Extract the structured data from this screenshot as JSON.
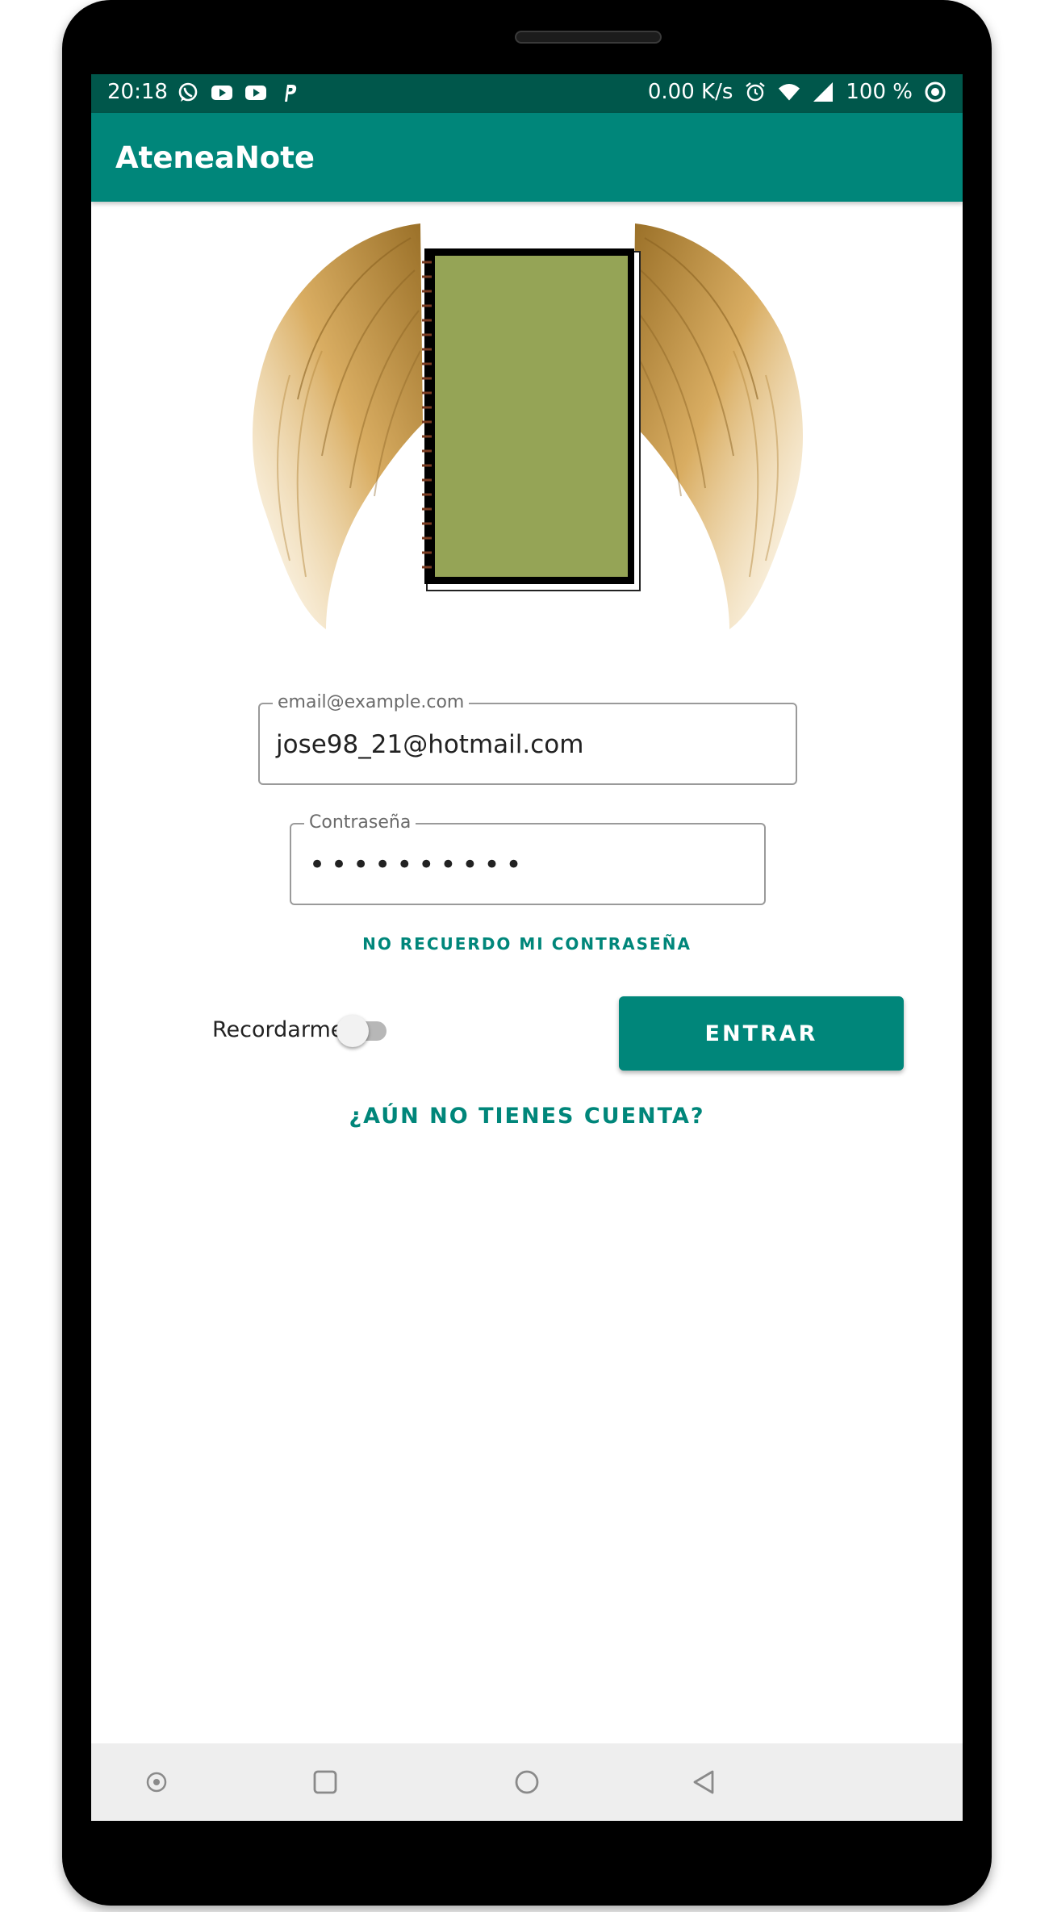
{
  "status_bar": {
    "time": "20:18",
    "net_speed": "0.00 K/s",
    "battery": "100 %",
    "left_icons": [
      "whatsapp-icon",
      "youtube-icon",
      "youtube-icon",
      "paypal-icon"
    ],
    "right_icons": [
      "alarm-icon",
      "wifi-icon",
      "signal-icon",
      "battery-saver-icon"
    ]
  },
  "app_bar": {
    "title": "AteneaNote"
  },
  "login": {
    "email_label": "email@example.com",
    "email_value": "jose98_21@hotmail.com",
    "password_label": "Contraseña",
    "password_masked": "••••••••••",
    "forgot_password": "NO RECUERDO MI CONTRASEÑA",
    "remember_label": "Recordarme",
    "remember_checked": false,
    "enter_button": "ENTRAR",
    "signup_link": "¿AÚN NO TIENES CUENTA?"
  },
  "nav_bar": {
    "icons": [
      "assistant-icon",
      "recents-icon",
      "home-icon",
      "back-icon"
    ]
  },
  "colors": {
    "status_bar": "#00574b",
    "app_bar": "#00867a",
    "accent": "#00867a",
    "notebook_cover": "#95a456",
    "wing_gold": "#c99a4a"
  }
}
